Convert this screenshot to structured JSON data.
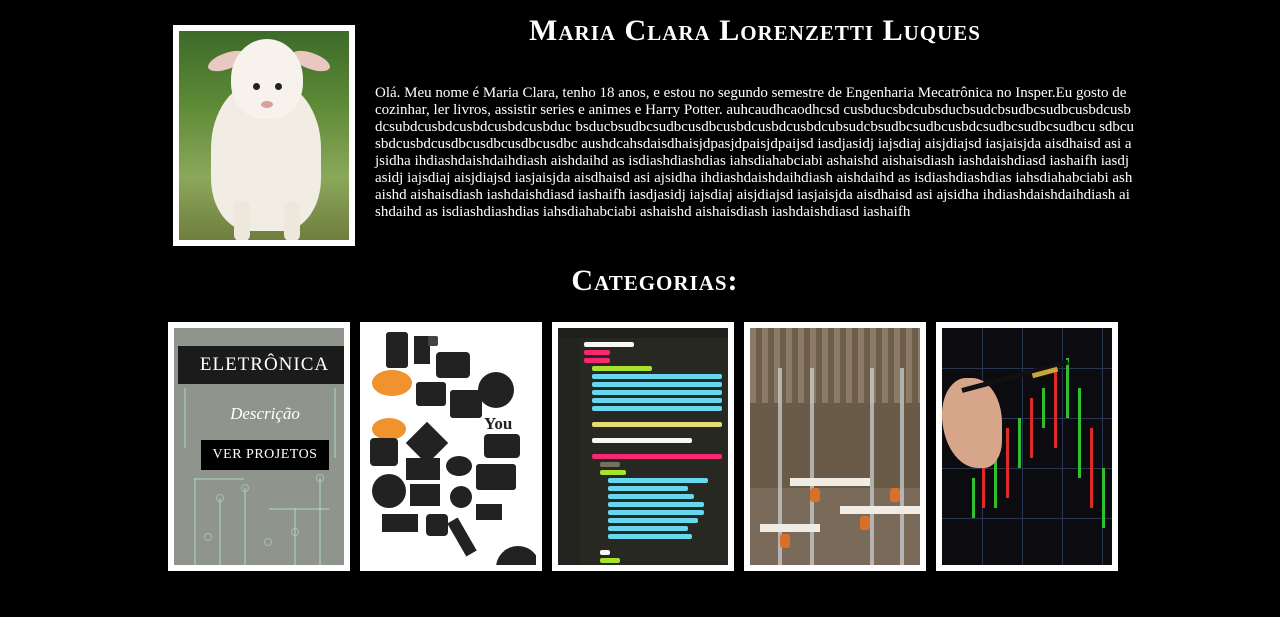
{
  "profile": {
    "name": "Maria Clara Lorenzetti Luques",
    "photo_alt": "lamb",
    "bio": "Olá. Meu nome é Maria Clara, tenho 18 anos, e estou no segundo semestre de Engenharia Mecatrônica no Insper.Eu gosto de cozinhar, ler livros, assistir series e animes e Harry Potter. auhcaudhcaodhcsd cusbducsbdcubsducbsudcbsudbcsudbcusbdcusbdcsubdcusbdcusbdcusbdcusbduc bsducbsudbcsudbcusdbcusbdcusbdcusbdcubsudcbsudbcsudbcusbdcsudbcsudbcsudbcu sdbcusbdcusbdcusdbcusdbcusdbcusdbc aushdcahsdaisdhaisjdpasjdpaisjdpaijsd iasdjasidj iajsdiaj aisjdiajsd iasjaisjda aisdhaisd asi ajsidha ihdiashdaishdaihdiash aishdaihd as isdiashdiashdias iahsdiahabciabi ashaishd aishaisdiash iashdaishdiasd iashaifh iasdjasidj iajsdiaj aisjdiajsd iasjaisjda aisdhaisd asi ajsidha ihdiashdaishdaihdiash aishdaihd as isdiashdiashdias iahsdiahabciabi ashaishd aishaisdiash iashdaishdiasd iashaifh iasdjasidj iajsdiaj aisjdiajsd iasjaisjda aisdhaisd asi ajsidha ihdiashdaishdaihdiash aishdaihd as isdiashdiashdias iahsdiahabciabi ashaishd aishaisdiash iashdaishdiasd iashaifh"
  },
  "categories": {
    "title": "Categorias:",
    "cards": [
      {
        "label": "ELETRÔNICA",
        "description": "Descrição",
        "button": "VER PROJETOS",
        "icon": "circuit-board-icon"
      },
      {
        "icon": "media-icons-collage"
      },
      {
        "icon": "code-editor-screenshot"
      },
      {
        "icon": "office-photo"
      },
      {
        "icon": "stock-chart-photo"
      }
    ]
  },
  "colors": {
    "background": "#000000",
    "text": "#ffffff",
    "frame": "#ffffff"
  }
}
